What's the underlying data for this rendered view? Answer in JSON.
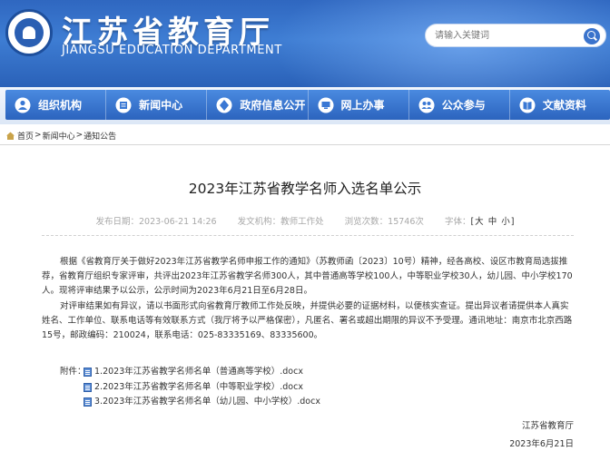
{
  "header": {
    "title": "江苏省教育厅",
    "subtitle": "JIANGSU EDUCATION DEPARTMENT",
    "search_placeholder": "请输入关键词"
  },
  "nav": {
    "items": [
      {
        "label": "组织机构",
        "icon": "org-icon"
      },
      {
        "label": "新闻中心",
        "icon": "news-icon"
      },
      {
        "label": "政府信息公开",
        "icon": "info-open-icon"
      },
      {
        "label": "网上办事",
        "icon": "online-service-icon"
      },
      {
        "label": "公众参与",
        "icon": "public-participation-icon"
      },
      {
        "label": "文献资料",
        "icon": "documents-icon"
      }
    ]
  },
  "breadcrumb": {
    "items": [
      "首页",
      "新闻中心",
      "通知公告"
    ],
    "separator": ">"
  },
  "article": {
    "title": "2023年江苏省教学名师入选名单公示",
    "publish_time": "发布日期：2023-06-21 14:26",
    "source": "发文机构：教师工作处",
    "views": "浏览次数：15746次",
    "font_label": "字体：",
    "font_sizes": [
      "大",
      "中",
      "小"
    ],
    "paragraphs": [
      "根据《省教育厅关于做好2023年江苏省教学名师申报工作的通知》（苏教师函〔2023〕10号）精神，经各高校、设区市教育局选拔推荐，省教育厅组织专家评审，共评出2023年江苏省教学名师300人，其中普通高等学校100人，中等职业学校30人，幼儿园、中小学校170人。现将评审结果予以公示，公示时间为2023年6月21日至6月28日。",
      "对评审结果如有异议，请以书面形式向省教育厅教师工作处反映，并提供必要的证据材料，以便核实查证。提出异议者请提供本人真实姓名、工作单位、联系电话等有效联系方式（我厅将予以严格保密），凡匿名、署名或超出期限的异议不予受理。通讯地址：南京市北京西路15号，邮政编码：210024，联系电话：025-83335169、83335600。"
    ],
    "attachments_label": "附件：",
    "attachments": [
      "1.2023年江苏省教学名师名单（普通高等学校）.docx",
      "2.2023年江苏省教学名师名单（中等职业学校）.docx",
      "3.2023年江苏省教学名师名单（幼儿园、中小学校）.docx"
    ],
    "signature_org": "江苏省教育厅",
    "signature_date": "2023年6月21日"
  },
  "colors": {
    "header_blue": "#2f67c0",
    "nav_blue": "#3a78d4",
    "text": "#333333",
    "meta_gray": "#a8a8a8"
  }
}
